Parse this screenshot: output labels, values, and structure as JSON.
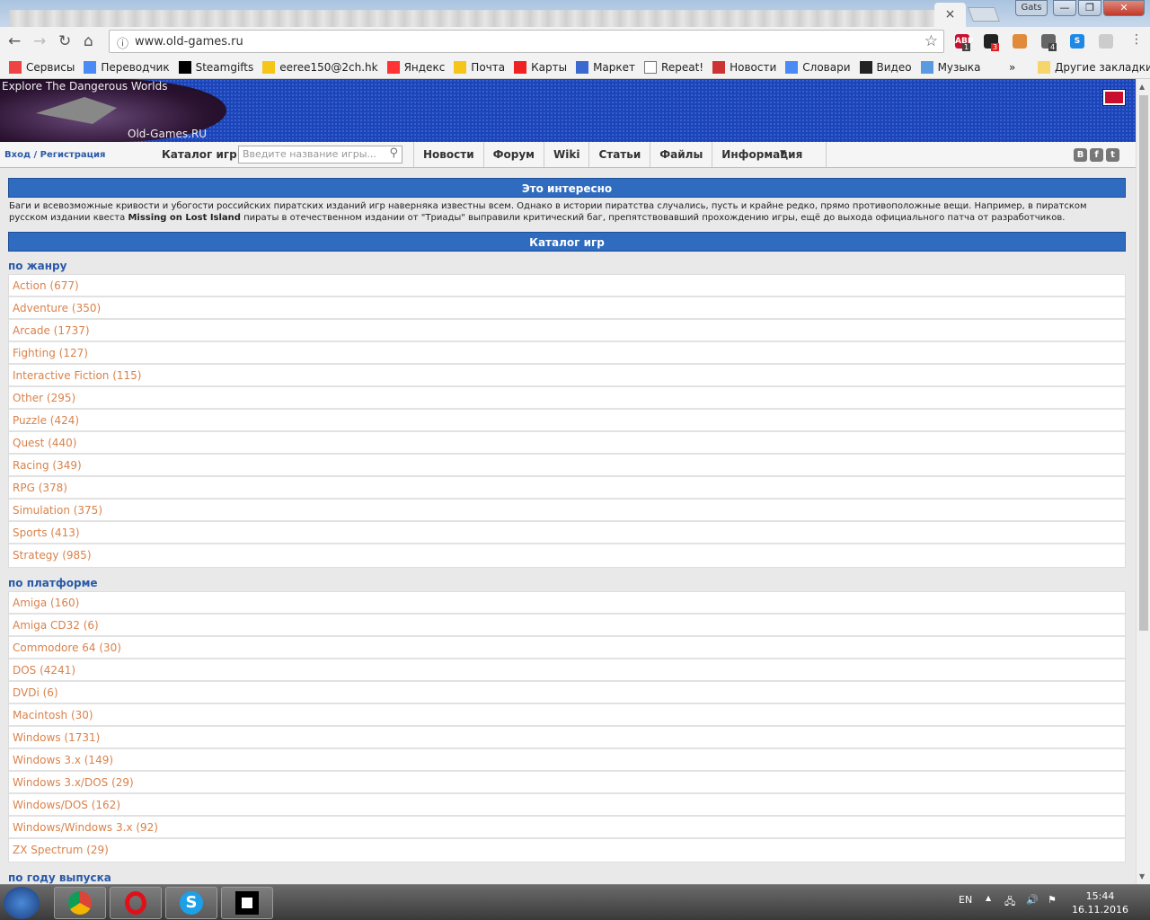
{
  "browser": {
    "tab_close": "×",
    "profile": "Gats",
    "url": "www.old-games.ru",
    "bookmarks": [
      {
        "label": "Сервисы",
        "icon": "apps-icon"
      },
      {
        "label": "Переводчик",
        "icon": "translate-icon"
      },
      {
        "label": "Steamgifts",
        "icon": "steamgifts-icon"
      },
      {
        "label": "eeree150@2ch.hk",
        "icon": "mail-icon"
      },
      {
        "label": "Яндекс",
        "icon": "yandex-icon"
      },
      {
        "label": "Почта",
        "icon": "mail-icon"
      },
      {
        "label": "Карты",
        "icon": "map-pin-icon"
      },
      {
        "label": "Маркет",
        "icon": "market-icon"
      },
      {
        "label": "Repeat!",
        "icon": "page-icon"
      },
      {
        "label": "Новости",
        "icon": "news-icon"
      },
      {
        "label": "Словари",
        "icon": "dictionary-icon"
      },
      {
        "label": "Видео",
        "icon": "video-icon"
      },
      {
        "label": "Музыка",
        "icon": "music-icon"
      }
    ],
    "more_bookmarks": "»",
    "other_bookmarks": "Другие закладки",
    "extensions": [
      {
        "label": "ABP",
        "badge": "1",
        "color": "#c8102e"
      },
      {
        "label": "",
        "badge": "3",
        "color": "#222"
      },
      {
        "label": "",
        "badge": "",
        "color": "#e08a3a"
      },
      {
        "label": "",
        "badge": "4",
        "color": "#666"
      },
      {
        "label": "S",
        "badge": "",
        "color": "#1e88e5"
      },
      {
        "label": "",
        "badge": "",
        "color": "#ccc"
      }
    ]
  },
  "banner": {
    "tagline": "Explore The Dangerous Worlds",
    "site": "Old-Games.RU"
  },
  "nav": {
    "login": "Вход / Регистрация",
    "catalog": "Каталог игр",
    "search_placeholder": "Введите название игры...",
    "menu": [
      "Новости",
      "Форум",
      "Wiki",
      "Статьи",
      "Файлы",
      "Информация"
    ],
    "social": [
      "B",
      "f",
      "t"
    ]
  },
  "fact": {
    "title": "Это интересно",
    "text_before": "Баги и всевозможные кривости и убогости российских пиратских изданий игр наверняка известны всем. Однако в истории пиратства случались, пусть и крайне редко, прямо противоположные вещи. Например, в пиратском русском издании квеста ",
    "bold": "Missing on Lost Island",
    "text_after": " пираты в отечественном издании от \"Триады\" выправили критический баг, препятствовавший прохождению игры, ещё до выхода официального патча от разработчиков."
  },
  "catalog": {
    "title": "Каталог игр",
    "genre_title": "по жанру",
    "genres": [
      "Action (677)",
      "Adventure (350)",
      "Arcade (1737)",
      "Fighting (127)",
      "Interactive Fiction (115)",
      "Other (295)",
      "Puzzle (424)",
      "Quest (440)",
      "Racing (349)",
      "RPG (378)",
      "Simulation (375)",
      "Sports (413)",
      "Strategy (985)"
    ],
    "platform_title": "по платформе",
    "platforms": [
      "Amiga (160)",
      "Amiga CD32 (6)",
      "Commodore 64 (30)",
      "DOS (4241)",
      "DVDi (6)",
      "Macintosh (30)",
      "Windows (1731)",
      "Windows 3.x (149)",
      "Windows 3.x/DOS (29)",
      "Windows/DOS (162)",
      "Windows/Windows 3.x (92)",
      "ZX Spectrum (29)"
    ],
    "year_title": "по году выпуска"
  },
  "taskbar": {
    "lang": "EN",
    "time": "15:44",
    "date": "16.11.2016"
  }
}
